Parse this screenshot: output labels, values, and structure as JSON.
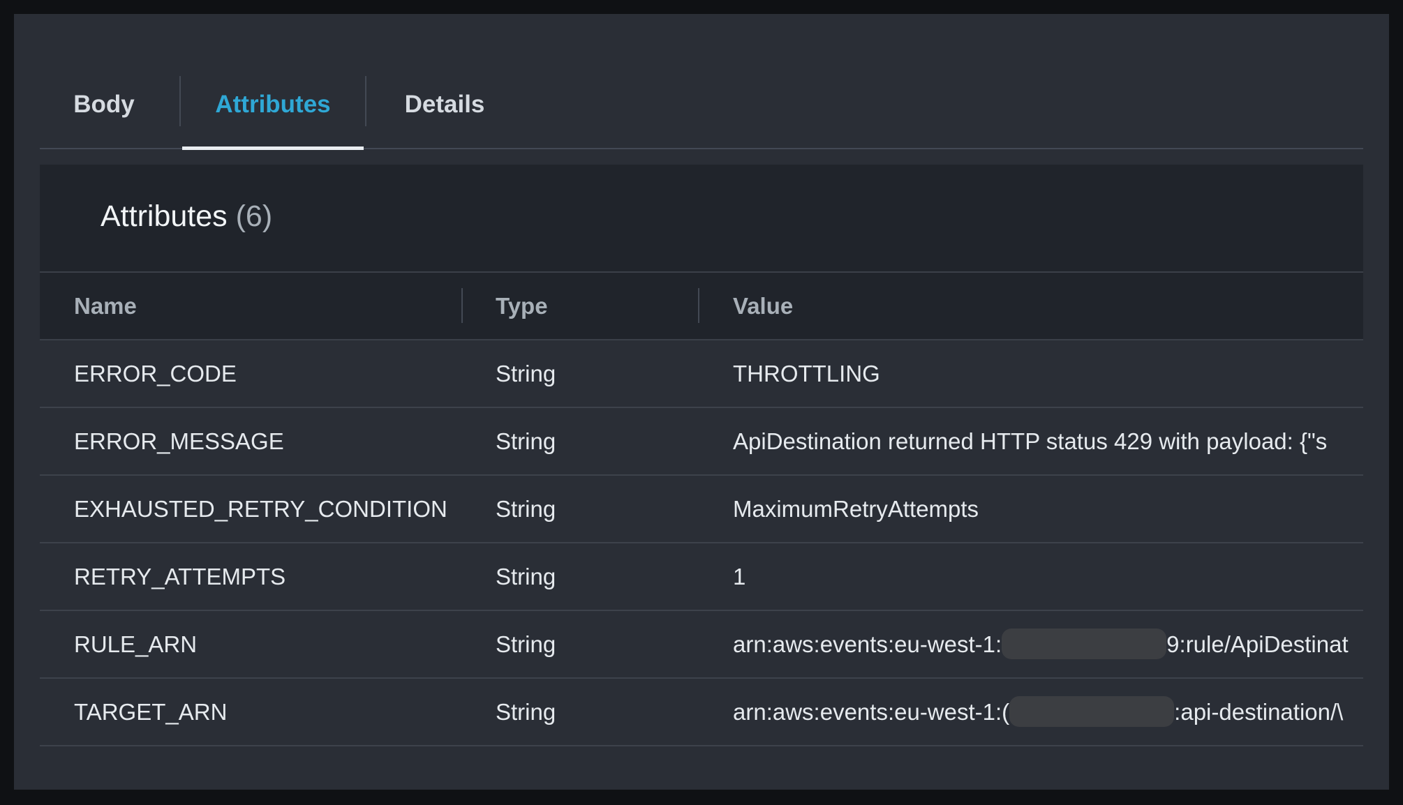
{
  "tabs": [
    {
      "label": "Body",
      "active": false
    },
    {
      "label": "Attributes",
      "active": true
    },
    {
      "label": "Details",
      "active": false
    }
  ],
  "panel": {
    "title": "Attributes",
    "count": "(6)"
  },
  "table": {
    "columns": [
      "Name",
      "Type",
      "Value"
    ],
    "rows": [
      {
        "name": "ERROR_CODE",
        "type": "String",
        "value": "THROTTLING"
      },
      {
        "name": "ERROR_MESSAGE",
        "type": "String",
        "value": "ApiDestination returned HTTP status 429 with payload: {\"s"
      },
      {
        "name": "EXHAUSTED_RETRY_CONDITION",
        "type": "String",
        "value": "MaximumRetryAttempts"
      },
      {
        "name": "RETRY_ATTEMPTS",
        "type": "String",
        "value": "1"
      },
      {
        "name": "RULE_ARN",
        "type": "String",
        "value_prefix": "arn:aws:events:eu-west-1:",
        "value_suffix": "9:rule/ApiDestinat"
      },
      {
        "name": "TARGET_ARN",
        "type": "String",
        "value_prefix": "arn:aws:events:eu-west-1:(",
        "value_suffix": ":api-destination/\\"
      }
    ]
  },
  "colors": {
    "accent": "#2fa8d6",
    "background": "#2a2e36",
    "header_background": "#20242b"
  }
}
